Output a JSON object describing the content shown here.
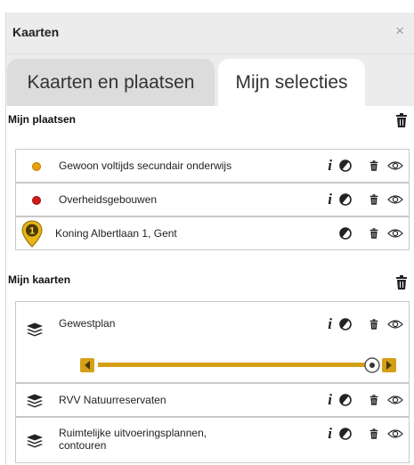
{
  "window": {
    "title": "Kaarten",
    "close_glyph": "×"
  },
  "tabs": [
    {
      "label": "Kaarten en plaatsen",
      "active": false
    },
    {
      "label": "Mijn selecties",
      "active": true
    }
  ],
  "places": {
    "title": "Mijn plaatsen",
    "items": [
      {
        "label": "Gewoon voltijds secundair onderwijs",
        "marker": "dot",
        "color": "#e8a00c",
        "has_info": true
      },
      {
        "label": "Overheidsgebouwen",
        "marker": "dot",
        "color": "#d31a1a",
        "has_info": true
      },
      {
        "label": "Koning Albertlaan 1, Gent",
        "marker": "pin",
        "pin_number": "1",
        "color": "#e8b416",
        "has_info": false
      }
    ]
  },
  "maps": {
    "title": "Mijn kaarten",
    "items": [
      {
        "label": "Gewestplan",
        "has_slider": true,
        "opacity": 1.0
      },
      {
        "label": "RVV Natuurreservaten",
        "has_slider": false
      },
      {
        "label": "Ruimtelijke uitvoeringsplannen, contouren",
        "has_slider": false
      }
    ]
  },
  "icons": {
    "info": "i",
    "contrast": "contrast-icon",
    "delete": "trash-icon",
    "visibility": "eye-icon",
    "layers": "layers-icon"
  },
  "colors": {
    "accent": "#d4a017",
    "header_bg": "#ececec"
  }
}
